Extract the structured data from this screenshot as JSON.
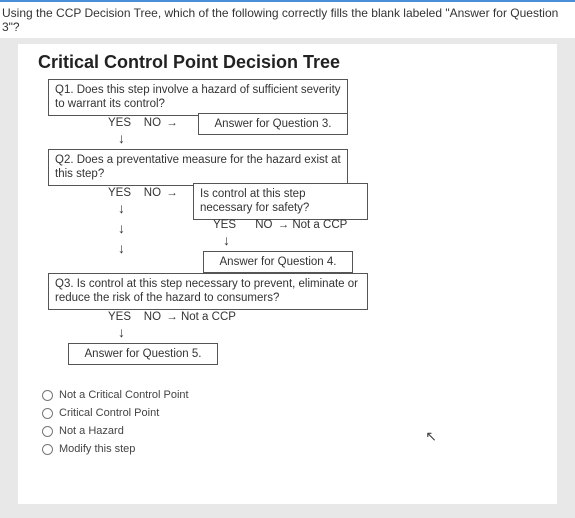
{
  "prompt": "Using the CCP Decision Tree, which of the following correctly fills the blank labeled \"Answer for Question 3\"?",
  "title": "Critical Control Point Decision Tree",
  "q1": {
    "text": "Q1. Does this step involve a hazard of sufficient severity to warrant its control?",
    "yes": "YES",
    "no": "NO",
    "answer": "Answer for Question 3."
  },
  "q2": {
    "text": "Q2. Does a preventative measure for the hazard exist at this step?",
    "yes": "YES",
    "no": "NO",
    "sub": {
      "text": "Is control at this step necessary for safety?",
      "yes": "YES",
      "no": "NO",
      "notccp": "Not a CCP",
      "answer": "Answer for Question 4."
    }
  },
  "q3": {
    "text": "Q3. Is control at this step necessary to prevent, eliminate or reduce the risk of the hazard to consumers?",
    "yes": "YES",
    "no": "NO",
    "notccp": "Not a CCP",
    "answer": "Answer for Question 5."
  },
  "options": [
    "Not a Critical Control Point",
    "Critical Control Point",
    "Not a Hazard",
    "Modify this step"
  ]
}
